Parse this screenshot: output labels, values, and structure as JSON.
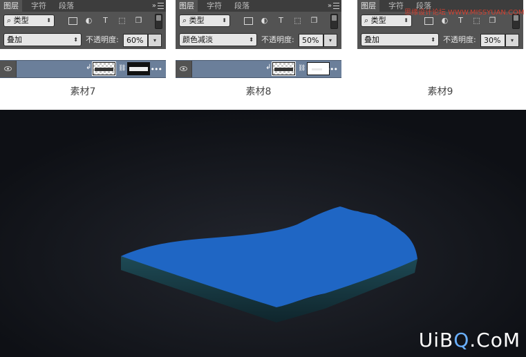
{
  "panels": [
    {
      "tabs": [
        "图层",
        "字符",
        "段落"
      ],
      "filter_kind": "类型",
      "blend_mode": "叠加",
      "opacity_label": "不透明度:",
      "opacity_value": "60%",
      "caption": "素材7"
    },
    {
      "tabs": [
        "图层",
        "字符",
        "段落"
      ],
      "filter_kind": "类型",
      "blend_mode": "颜色减淡",
      "opacity_label": "不透明度:",
      "opacity_value": "50%",
      "caption": "素材8"
    },
    {
      "tabs": [
        "图层",
        "字符",
        "段落"
      ],
      "filter_kind": "类型",
      "blend_mode": "叠加",
      "opacity_label": "不透明度:",
      "opacity_value": "30%",
      "caption": "素材9"
    }
  ],
  "watermark_top": "思缘设计论坛 WWW.MISSYUAN.COM",
  "brand": {
    "part1": "UiB",
    "part2": "Q",
    "part3": ".CoM"
  },
  "colors": {
    "panel_bg": "#535353",
    "scene_bg": "#14161c",
    "shape_blue": "#1f66c4",
    "shape_side": "#1b3a45"
  }
}
